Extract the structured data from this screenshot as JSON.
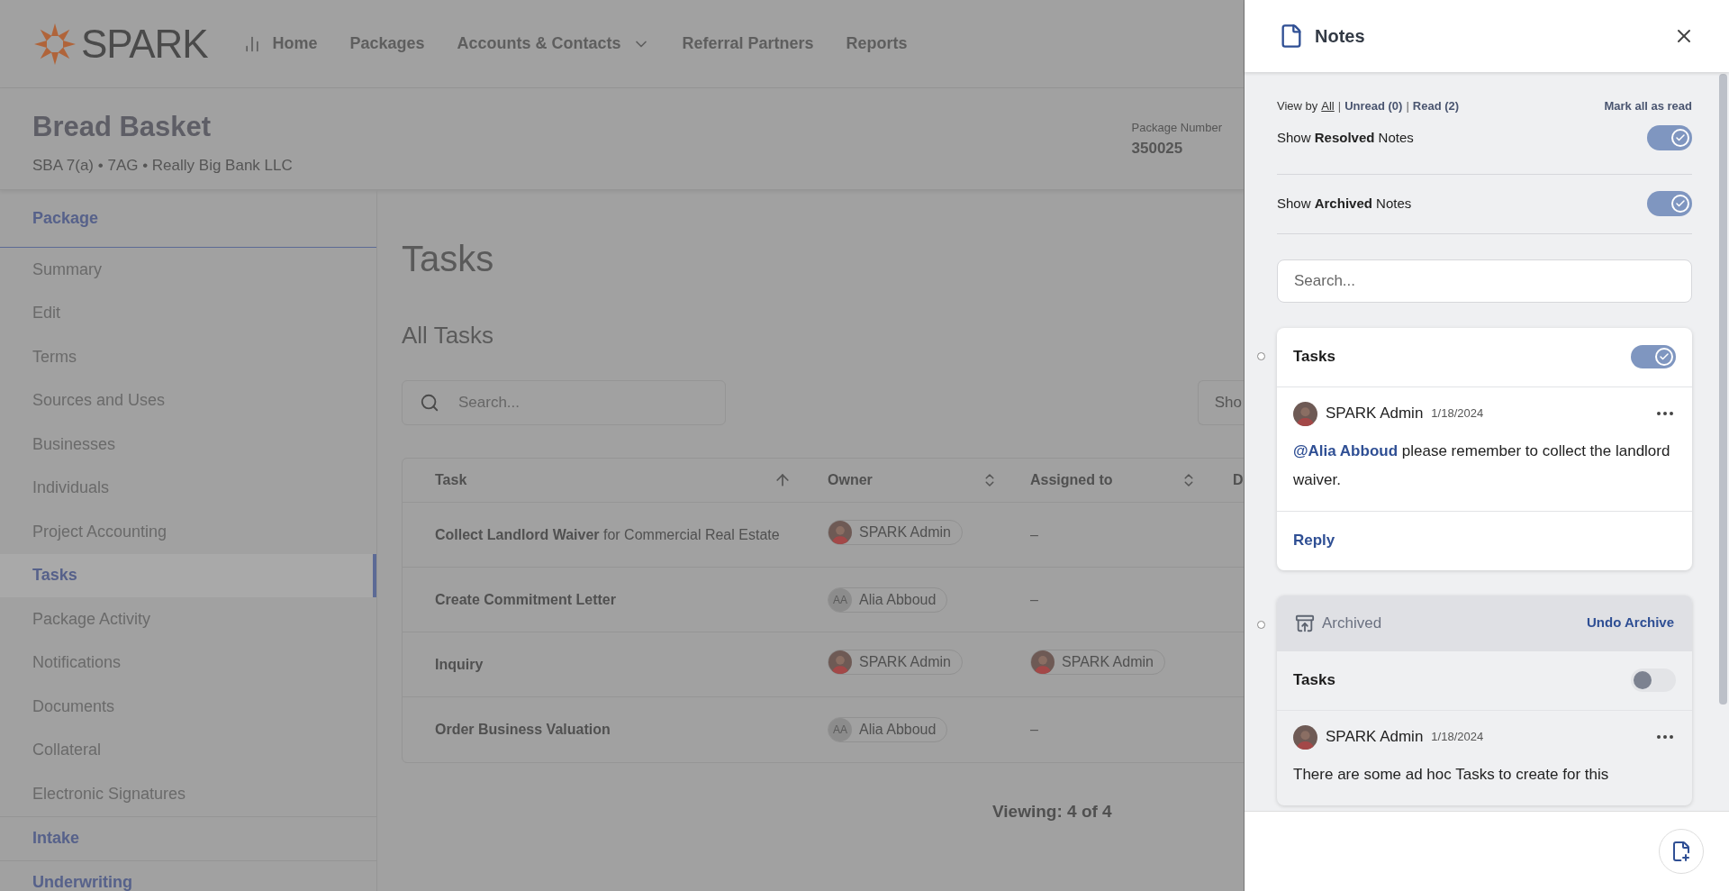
{
  "nav": {
    "logo": "SPARK",
    "items": [
      {
        "label": "Home",
        "icon": true,
        "dropdown": false
      },
      {
        "label": "Packages",
        "icon": false,
        "dropdown": false
      },
      {
        "label": "Accounts & Contacts",
        "icon": false,
        "dropdown": true
      },
      {
        "label": "Referral Partners",
        "icon": false,
        "dropdown": false
      },
      {
        "label": "Reports",
        "icon": false,
        "dropdown": false
      }
    ]
  },
  "package": {
    "title": "Bread Basket",
    "subtitle": "SBA 7(a) • 7AG • Really Big Bank LLC",
    "number_label": "Package Number",
    "number": "350025"
  },
  "sidebar": [
    {
      "label": "Package",
      "kind": "section",
      "selected": false
    },
    {
      "label": "Summary",
      "kind": "item",
      "selected": false
    },
    {
      "label": "Edit",
      "kind": "item",
      "selected": false
    },
    {
      "label": "Terms",
      "kind": "item",
      "selected": false
    },
    {
      "label": "Sources and Uses",
      "kind": "item",
      "selected": false
    },
    {
      "label": "Businesses",
      "kind": "item",
      "selected": false
    },
    {
      "label": "Individuals",
      "kind": "item",
      "selected": false
    },
    {
      "label": "Project Accounting",
      "kind": "item",
      "selected": false
    },
    {
      "label": "Tasks",
      "kind": "item",
      "selected": true
    },
    {
      "label": "Package Activity",
      "kind": "item",
      "selected": false
    },
    {
      "label": "Notifications",
      "kind": "item",
      "selected": false
    },
    {
      "label": "Documents",
      "kind": "item",
      "selected": false
    },
    {
      "label": "Collateral",
      "kind": "item",
      "selected": false
    },
    {
      "label": "Electronic Signatures",
      "kind": "item",
      "selected": false
    },
    {
      "label": "Intake",
      "kind": "section",
      "selected": false
    },
    {
      "label": "Underwriting",
      "kind": "section",
      "selected": false
    }
  ],
  "main": {
    "title": "Tasks",
    "subtitle": "All Tasks",
    "search": {
      "placeholder": "Search..."
    },
    "show_button": "Sho",
    "table": {
      "columns": [
        {
          "label": "Task",
          "sortable": true,
          "sorted": true
        },
        {
          "label": "Owner",
          "sortable": true,
          "sorted": false
        },
        {
          "label": "Assigned to",
          "sortable": true,
          "sorted": false
        },
        {
          "label": "D"
        }
      ],
      "rows": [
        {
          "task": "Collect Landlord Waiver",
          "detail": "for Commercial Real Estate",
          "owner": {
            "kind": "photo",
            "name": "SPARK Admin"
          },
          "assigned": {
            "kind": "none",
            "name": "–"
          }
        },
        {
          "task": "Create Commitment Letter",
          "owner": {
            "kind": "initials",
            "initials": "AA",
            "name": "Alia Abboud"
          },
          "assigned": {
            "kind": "none",
            "name": "–"
          }
        },
        {
          "task": "Inquiry",
          "owner": {
            "kind": "photo",
            "name": "SPARK Admin"
          },
          "assigned": {
            "kind": "photo",
            "name": "SPARK Admin"
          }
        },
        {
          "task": "Order Business Valuation",
          "owner": {
            "kind": "initials",
            "initials": "AA",
            "name": "Alia Abboud"
          },
          "assigned": {
            "kind": "none",
            "name": "–"
          }
        }
      ]
    },
    "footer": "Viewing: 4 of 4"
  },
  "notes": {
    "title": "Notes",
    "view_by": {
      "label": "View by",
      "separator": "|",
      "filters": [
        {
          "label": "All",
          "selected": true
        },
        {
          "label": "Unread (0)",
          "selected": false
        },
        {
          "label": "Read (2)",
          "selected": false
        }
      ]
    },
    "mark_all": "Mark all as read",
    "toggles": [
      {
        "label": "Show **Resolved** Notes",
        "on": true
      },
      {
        "label": "Show **Archived** Notes",
        "on": true
      }
    ],
    "search": {
      "placeholder": "Search..."
    },
    "cards": [
      {
        "archived": false,
        "topic": "Tasks",
        "resolved": true,
        "author": "SPARK Admin",
        "date": "1/18/2024",
        "mention": "@Alia Abboud",
        "text": "please remember to collect the landlord waiver.",
        "reply": "Reply"
      },
      {
        "archived": true,
        "archived_label": "Archived",
        "undo": "Undo Archive",
        "topic": "Tasks",
        "resolved": false,
        "author": "SPARK Admin",
        "date": "1/18/2024",
        "text": "There are some ad hoc Tasks to create for this"
      }
    ]
  }
}
